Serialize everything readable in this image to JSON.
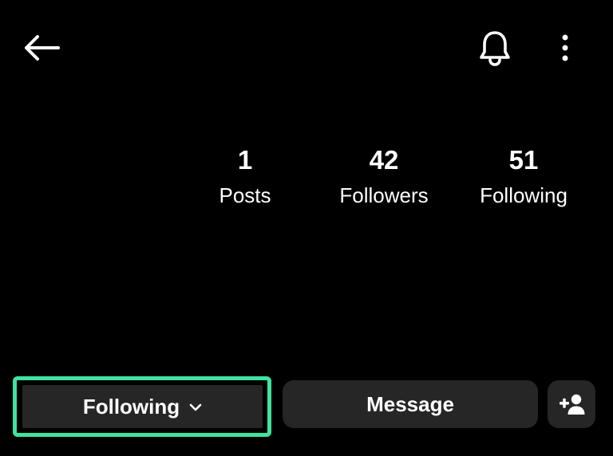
{
  "header": {
    "back_icon": "arrow-left-icon",
    "notifications_icon": "bell-icon",
    "more_icon": "more-vertical-icon"
  },
  "stats": {
    "posts": {
      "count": "1",
      "label": "Posts"
    },
    "followers": {
      "count": "42",
      "label": "Followers"
    },
    "following": {
      "count": "51",
      "label": "Following"
    }
  },
  "actions": {
    "following_label": "Following",
    "message_label": "Message",
    "add_user_icon": "person-add-icon",
    "highlight_color": "#3fe39e",
    "button_color": "#262626"
  }
}
